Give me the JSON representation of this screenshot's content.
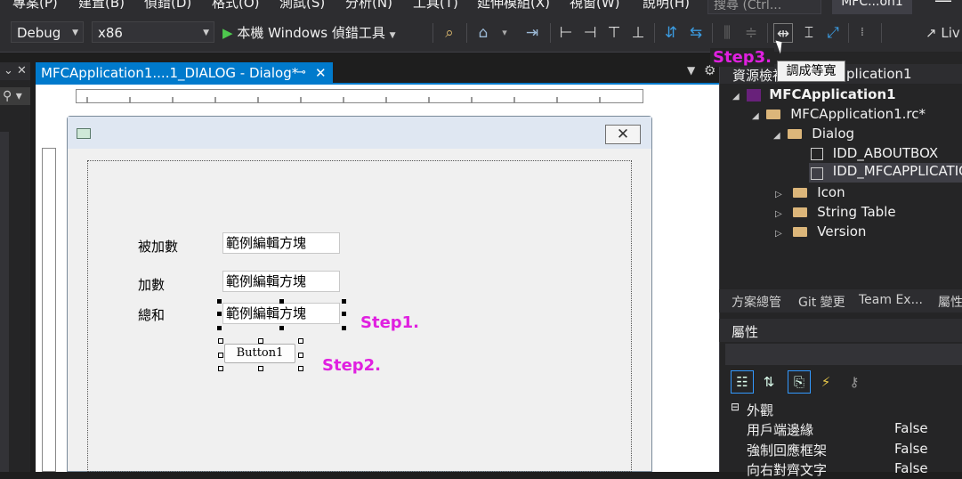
{
  "menu": [
    "專案(P)",
    "建置(B)",
    "偵錯(D)",
    "格式(O)",
    "測試(S)",
    "分析(N)",
    "工具(T)",
    "延伸模組(X)",
    "視窗(W)",
    "說明(H)"
  ],
  "search_placeholder": "搜尋 (Ctrl...",
  "app_title_short": "MFC...on1",
  "toolbar": {
    "config": "Debug",
    "platform": "x86",
    "run_label": "本機 Windows 偵錯工具",
    "live_share": "Liv"
  },
  "tab": {
    "title": "MFCApplication1....1_DIALOG - Dialog*",
    "pin_icon": "pin-icon",
    "close_icon": "close-icon"
  },
  "dialog": {
    "labels": [
      "被加數",
      "加數",
      "總和"
    ],
    "edit_text": "範例編輯方塊",
    "button_text": "Button1"
  },
  "annotations": {
    "step1": "Step1.",
    "step2": "Step2.",
    "step3": "Step3."
  },
  "tooltip": "調成等寬",
  "resource_view": {
    "header": "資源檢視",
    "header_suffix": "plication1",
    "root": "MFCApplication1",
    "rc": "MFCApplication1.rc*",
    "dialog_folder": "Dialog",
    "items": [
      "IDD_ABOUTBOX",
      "IDD_MFCAPPLICATIO"
    ],
    "folders": [
      "Icon",
      "String Table",
      "Version"
    ]
  },
  "bottom_tabs": [
    "方案總管",
    "Git 變更",
    "Team Ex...",
    "屬性"
  ],
  "properties": {
    "header": "屬性",
    "category": "外觀",
    "rows": [
      {
        "key": "用戶端邊緣",
        "value": "False"
      },
      {
        "key": "強制回應框架",
        "value": "False"
      },
      {
        "key": "向右對齊文字",
        "value": "False"
      }
    ]
  }
}
